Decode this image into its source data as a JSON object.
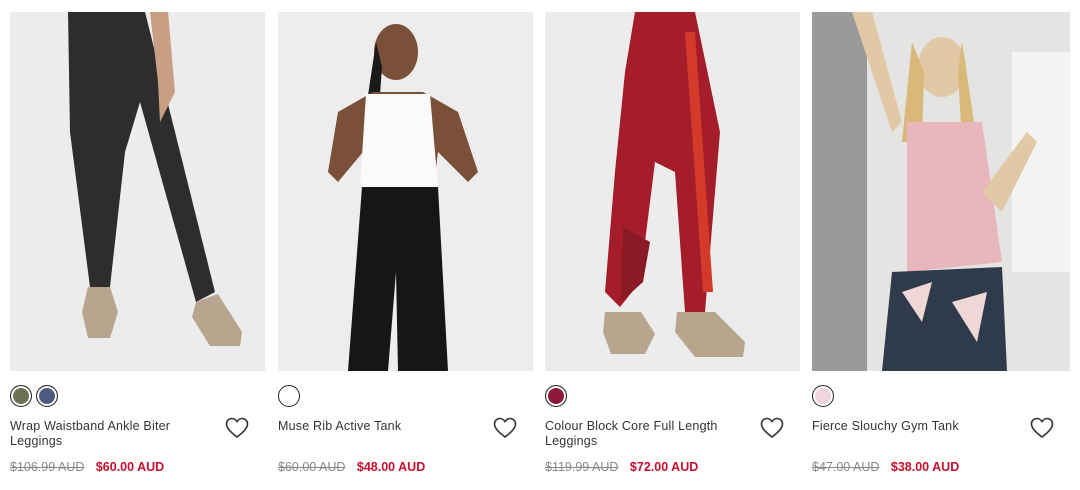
{
  "products": [
    {
      "name": "Wrap Waistband Ankle Biter Leggings",
      "was_price": "$106.99 AUD",
      "price": "$60.00 AUD",
      "swatches": [
        {
          "color": "#6b7256",
          "label": "khaki"
        },
        {
          "color": "#4d5a82",
          "label": "navy"
        }
      ],
      "image": "black-leggings-photo"
    },
    {
      "name": "Muse Rib Active Tank",
      "was_price": "$60.00 AUD",
      "price": "$48.00 AUD",
      "swatches": [
        {
          "color": "#ffffff",
          "label": "white"
        }
      ],
      "image": "white-tank-photo"
    },
    {
      "name": "Colour Block Core Full Length Leggings",
      "was_price": "$119.99 AUD",
      "price": "$72.00 AUD",
      "swatches": [
        {
          "color": "#8b1a3a",
          "label": "burgundy"
        }
      ],
      "image": "red-leggings-photo"
    },
    {
      "name": "Fierce Slouchy Gym Tank",
      "was_price": "$47.00 AUD",
      "price": "$38.00 AUD",
      "swatches": [
        {
          "color": "#f1d5dc",
          "label": "pink"
        }
      ],
      "image": "pink-tank-photo"
    }
  ],
  "colors": {
    "sale_red": "#c8102e",
    "strike_grey": "#888888"
  },
  "icons": {
    "wishlist": "heart-icon"
  }
}
